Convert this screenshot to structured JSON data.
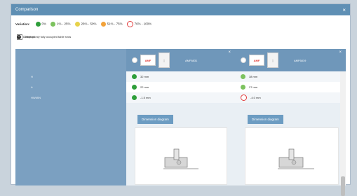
{
  "dialog": {
    "title": "Comparison",
    "close_symbol": "×"
  },
  "legend": {
    "label": "Variation:",
    "items": [
      {
        "label": "0%",
        "color": "#2e9e3a"
      },
      {
        "label": "1% - 25%",
        "color": "#7cc25e"
      },
      {
        "label": "26% - 50%",
        "color": "#e7d24a"
      },
      {
        "label": "51% - 75%",
        "color": "#f2a23a"
      },
      {
        "label": "76% - 100%",
        "color": "#e23b3b"
      }
    ]
  },
  "options": {
    "display_only_fully_occupied": "Display only fully occupied table rows",
    "delete_all": "Delete all"
  },
  "products": [
    {
      "name": "AMF6831",
      "logo_text": "AMF",
      "values": [
        {
          "text": "32 mm",
          "status_color": "#2e9e3a"
        },
        {
          "text": "22 mm",
          "status_color": "#2e9e3a"
        },
        {
          "text": "-1.5 mm",
          "status_color": "#2e9e3a"
        }
      ],
      "dimension_button": "Dimension diagram"
    },
    {
      "name": "AMF6819",
      "logo_text": "AMF",
      "values": [
        {
          "text": "38 mm",
          "status_color": "#7cc25e"
        },
        {
          "text": "27 mm",
          "status_color": "#7cc25e"
        },
        {
          "text": "-4.0 mm",
          "status_color": "#e23b3b"
        }
      ],
      "dimension_button": "Dimension diagram"
    }
  ],
  "row_labels": [
    "H",
    "A",
    "HWMIN"
  ]
}
